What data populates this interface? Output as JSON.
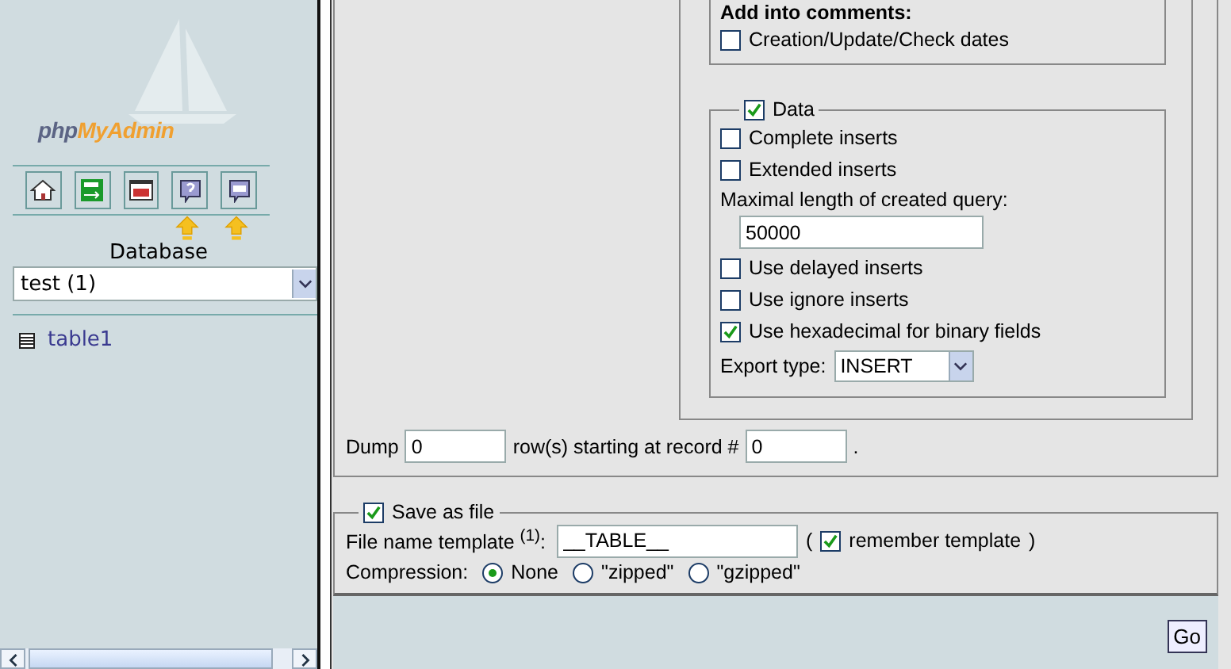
{
  "sidebar": {
    "logo": {
      "prefix": "php",
      "suffix": "MyAdmin"
    },
    "database_label": "Database",
    "database_select": "test (1)",
    "tables": [
      {
        "name": "table1"
      }
    ]
  },
  "comments": {
    "legend": "Add into comments:",
    "options": [
      {
        "label": "Creation/Update/Check dates",
        "checked": false
      }
    ]
  },
  "data": {
    "legend": "Data",
    "checked": true,
    "items": [
      {
        "kind": "checkbox",
        "label": "Complete inserts",
        "checked": false
      },
      {
        "kind": "checkbox",
        "label": "Extended inserts",
        "checked": false
      },
      {
        "kind": "field",
        "label": "Maximal length of created query:",
        "value": "50000"
      },
      {
        "kind": "checkbox",
        "label": "Use delayed inserts",
        "checked": false
      },
      {
        "kind": "checkbox",
        "label": "Use ignore inserts",
        "checked": false
      },
      {
        "kind": "checkbox",
        "label": "Use hexadecimal for binary fields",
        "checked": true
      },
      {
        "kind": "select",
        "label": "Export type:",
        "value": "INSERT"
      }
    ]
  },
  "dump": {
    "label": "Dump",
    "rows": "0",
    "middle": "row(s) starting at record #",
    "start": "0",
    "end": "."
  },
  "save_file": {
    "legend": "Save as file",
    "checked": true,
    "template_label": "File name template $^{(1)}$:",
    "template_value": "__TABLE__",
    "open_paren": "(",
    "remember": {
      "label": "remember template",
      "checked": true
    },
    "close_paren": ")",
    "compression_label": "Compression:",
    "compression_options": [
      {
        "label": "None",
        "selected": true
      },
      {
        "label": "\"zipped\"",
        "selected": false
      },
      {
        "label": "\"gzipped\"",
        "selected": false
      }
    ]
  },
  "go_button": "Go"
}
